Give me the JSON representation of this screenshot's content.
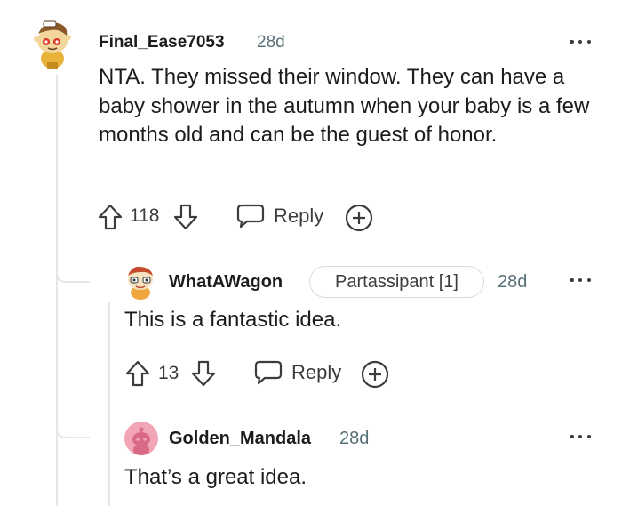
{
  "comments": [
    {
      "username": "Final_Ease7053",
      "age": "28d",
      "text": "NTA. They missed their window. They can have a baby shower in the autumn when your baby is a few months old and can be the guest of honor.",
      "score": "118",
      "reply_label": "Reply"
    },
    {
      "username": "WhatAWagon",
      "flair": "Partassipant [1]",
      "age": "28d",
      "text": "This is a fantastic idea.",
      "score": "13",
      "reply_label": "Reply"
    },
    {
      "username": "Golden_Mandala",
      "age": "28d",
      "text": "That’s a great idea."
    }
  ],
  "icons": {
    "upvote": "arrow-up-icon",
    "downvote": "arrow-down-icon",
    "reply": "speech-bubble-icon",
    "award": "plus-circle-icon",
    "more": "more-options-icon"
  },
  "colors": {
    "text": "#1c1c1c",
    "meta": "#576f76",
    "thread_line": "#e4e6e8",
    "avatar_pink": "#f2a5b6"
  }
}
